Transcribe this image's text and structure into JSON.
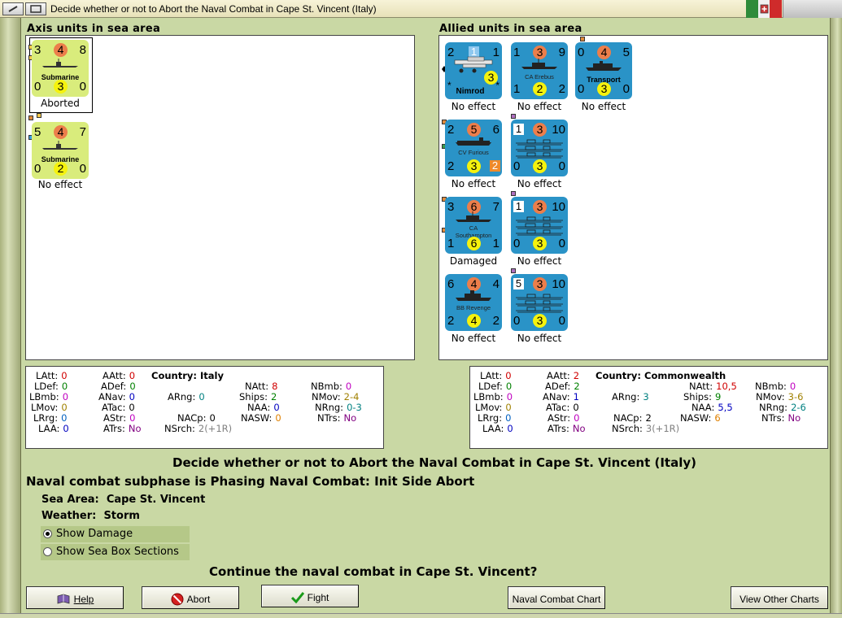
{
  "window": {
    "title": "Decide whether or not to Abort the Naval Combat in Cape St. Vincent (Italy)"
  },
  "axis_panel": {
    "heading": "Axis units in sea area",
    "units": [
      {
        "name": "Submarine",
        "tl": "3",
        "att": "4",
        "tr": "8",
        "bl": "0",
        "def": "3",
        "br": "0",
        "result": "Aborted",
        "color": "#d9ec7c"
      },
      {
        "name": "Submarine",
        "tl": "5",
        "att": "4",
        "tr": "7",
        "bl": "0",
        "def": "2",
        "br": "0",
        "result": "No effect",
        "color": "#d9ec7c"
      }
    ]
  },
  "allied_panel": {
    "heading": "Allied units in sea area",
    "units": [
      {
        "name": "Nimrod",
        "tl": "2",
        "att": "1",
        "tr": "1",
        "bl": "*",
        "def": "3",
        "br": "*",
        "result": "No effect"
      },
      {
        "name": "CA Erebus",
        "tl": "1",
        "att": "3",
        "tr": "9",
        "bl": "1",
        "def": "2",
        "br": "2",
        "result": "No effect"
      },
      {
        "name": "Transport",
        "tl": "0",
        "att": "4",
        "tr": "5",
        "bl": "0",
        "def": "3",
        "br": "0",
        "result": "No effect"
      },
      {
        "name": "CV Furious",
        "tl": "2",
        "att": "5",
        "tr": "6",
        "bl": "2",
        "def": "3",
        "br": "2",
        "result": "No effect"
      },
      {
        "name": "",
        "tl": "1",
        "att": "3",
        "tr": "10",
        "bl": "0",
        "def": "3",
        "br": "0",
        "result": "No effect"
      },
      {
        "name": "CA Southampton",
        "name1": "CA",
        "name2": "Southampton",
        "tl": "3",
        "att": "6",
        "tr": "7",
        "bl": "1",
        "def": "6",
        "br": "1",
        "result": "Damaged"
      },
      {
        "name": "",
        "tl": "1",
        "att": "3",
        "tr": "10",
        "bl": "0",
        "def": "3",
        "br": "0",
        "result": "No effect"
      },
      {
        "name": "BB Revenge",
        "tl": "6",
        "att": "4",
        "tr": "4",
        "bl": "2",
        "def": "4",
        "br": "2",
        "result": "No effect"
      },
      {
        "name": "",
        "tl": "5",
        "att": "3",
        "tr": "10",
        "bl": "0",
        "def": "3",
        "br": "0",
        "result": "No effect"
      }
    ]
  },
  "axis_stats": {
    "country_label": "Country:",
    "country": "Italy",
    "LAtt": "0",
    "LDef": "0",
    "LBmb": "0",
    "LMov": "0",
    "LRrg": "0",
    "LAA": "0",
    "AAtt": "0",
    "ADef": "0",
    "ANav": "0",
    "ATac": "0",
    "AStr": "0",
    "ATrs": "No",
    "ARng": "0",
    "NACp": "0",
    "NAtt": "8",
    "Ships": "2",
    "NAA": "0",
    "NASW": "0",
    "NSrch": "2(+1R)",
    "NBmb": "0",
    "NMov": "2-4",
    "NRng": "0-3",
    "NTrs": "No"
  },
  "allied_stats": {
    "country_label": "Country:",
    "country": "Commonwealth",
    "LAtt": "0",
    "LDef": "0",
    "LBmb": "0",
    "LMov": "0",
    "LRrg": "0",
    "LAA": "0",
    "AAtt": "2",
    "ADef": "2",
    "ANav": "1",
    "ATac": "0",
    "AStr": "0",
    "ATrs": "No",
    "ARng": "3",
    "NACp": "2",
    "NAtt": "10,5",
    "Ships": "9",
    "NAA": "5,5",
    "NASW": "6",
    "NSrch": "3(+1R)",
    "NBmb": "0",
    "NMov": "3-6",
    "NRng": "2-6",
    "NTrs": "No"
  },
  "main": {
    "heading": "Decide whether or not to Abort the Naval Combat in Cape St. Vincent (Italy)",
    "subphase": "Naval combat subphase is Phasing Naval Combat: Init Side Abort",
    "sea_area_label": "Sea Area:",
    "sea_area": "Cape St. Vincent",
    "weather_label": "Weather:",
    "weather": "Storm",
    "show_damage": "Show Damage",
    "show_sea_box": "Show Sea Box Sections",
    "question": "Continue the naval combat in Cape St. Vincent?"
  },
  "buttons": {
    "help": "Help",
    "abort": "Abort",
    "fight": "Fight",
    "naval_chart": "Naval Combat Chart",
    "other_charts": "View Other Charts"
  },
  "colors": {
    "background": "#c9d8a4",
    "axis_counter": "#d9ec7c",
    "allied_counter": "#2a93c7",
    "attack_circle": "#ec7e4b",
    "defense_circle": "#f5f20e"
  }
}
